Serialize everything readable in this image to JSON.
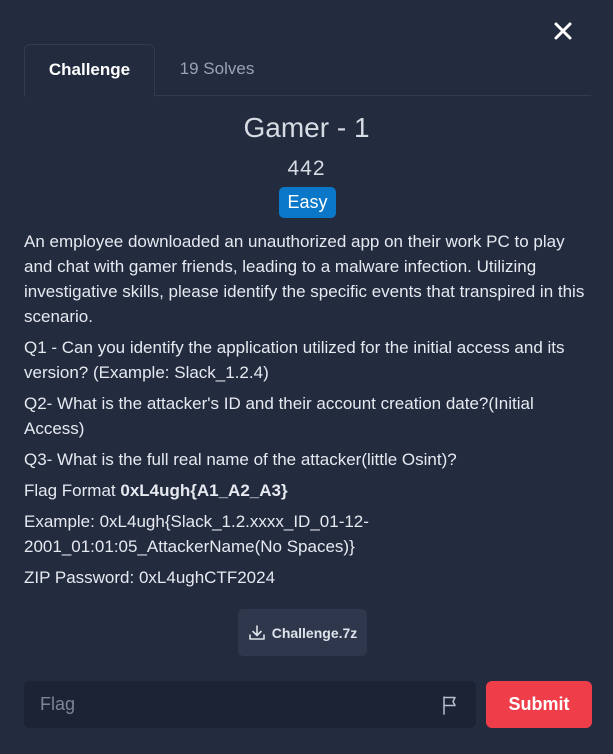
{
  "modal": {
    "close_icon": "close-icon"
  },
  "tabs": [
    {
      "label": "Challenge",
      "active": true
    },
    {
      "label": "19 Solves",
      "active": false
    }
  ],
  "challenge": {
    "title": "Gamer - 1",
    "points": "442",
    "difficulty": "Easy",
    "difficulty_color": "#0b77c9",
    "description": "An employee downloaded an unauthorized app on their work PC to play and chat with gamer friends, leading to a malware infection. Utilizing investigative skills, please identify the specific events that transpired in this scenario.",
    "q1": "Q1 - Can you identify the application utilized for the initial access and its version? (Example: Slack_1.2.4)",
    "q2": "Q2- What is the attacker's ID and their account creation date?(Initial Access)",
    "q3": "Q3- What is the full real name of the attacker(little Osint)?",
    "flag_format_label": "Flag Format ",
    "flag_format_value": "0xL4ugh{A1_A2_A3}",
    "example": "Example: 0xL4ugh{Slack_1.2.xxxx_ID_01-12-2001_01:01:05_AttackerName(No Spaces)}",
    "zip_password": "ZIP Password: 0xL4ughCTF2024"
  },
  "download": {
    "label": "Challenge.7z",
    "icon": "download-icon"
  },
  "flag_input": {
    "placeholder": "Flag",
    "value": "",
    "icon": "flag-icon"
  },
  "submit": {
    "label": "Submit",
    "color": "#ef3e4a"
  }
}
